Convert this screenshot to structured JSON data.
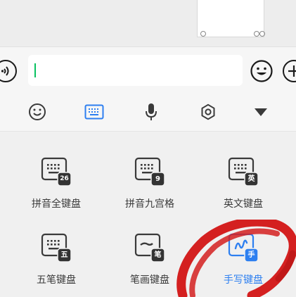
{
  "toolbar": {
    "icons": [
      "emoji-icon",
      "keyboard-icon",
      "mic-icon",
      "gear-icon",
      "triangle-down-icon"
    ],
    "active_color": "#2d7ff0"
  },
  "keyboards": [
    {
      "label": "拼音全键盘",
      "badge": "26",
      "active": false
    },
    {
      "label": "拼音九宫格",
      "badge": "9",
      "active": false
    },
    {
      "label": "英文键盘",
      "badge": "英",
      "active": false
    },
    {
      "label": "五笔键盘",
      "badge": "五",
      "active": false
    },
    {
      "label": "笔画键盘",
      "badge": "笔",
      "active": false
    },
    {
      "label": "手写键盘",
      "badge": "手",
      "active": true
    }
  ],
  "annotation_color": "#d42020"
}
